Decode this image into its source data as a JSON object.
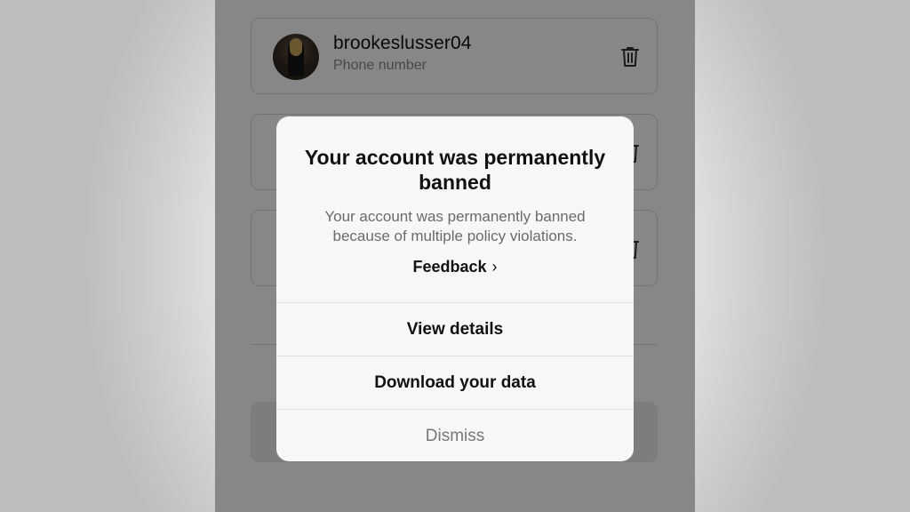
{
  "account": {
    "username": "brookeslusser04",
    "subtitle": "Phone number"
  },
  "icons": {
    "trash": "trash-icon",
    "chevron": "chevron-right-icon"
  },
  "dialog": {
    "title": "Your account was permanently banned",
    "body": "Your account was permanently banned because of multiple policy violations.",
    "feedback_label": "Feedback",
    "chevron_glyph": "›",
    "actions": [
      {
        "label": "View details"
      },
      {
        "label": "Download your data"
      },
      {
        "label": "Dismiss"
      }
    ]
  },
  "colors": {
    "overlay": "#000000",
    "dialog_bg": "#f7f7f7",
    "text_primary": "#111111",
    "text_secondary": "#6b6b6b",
    "muted_action": "#777777"
  }
}
